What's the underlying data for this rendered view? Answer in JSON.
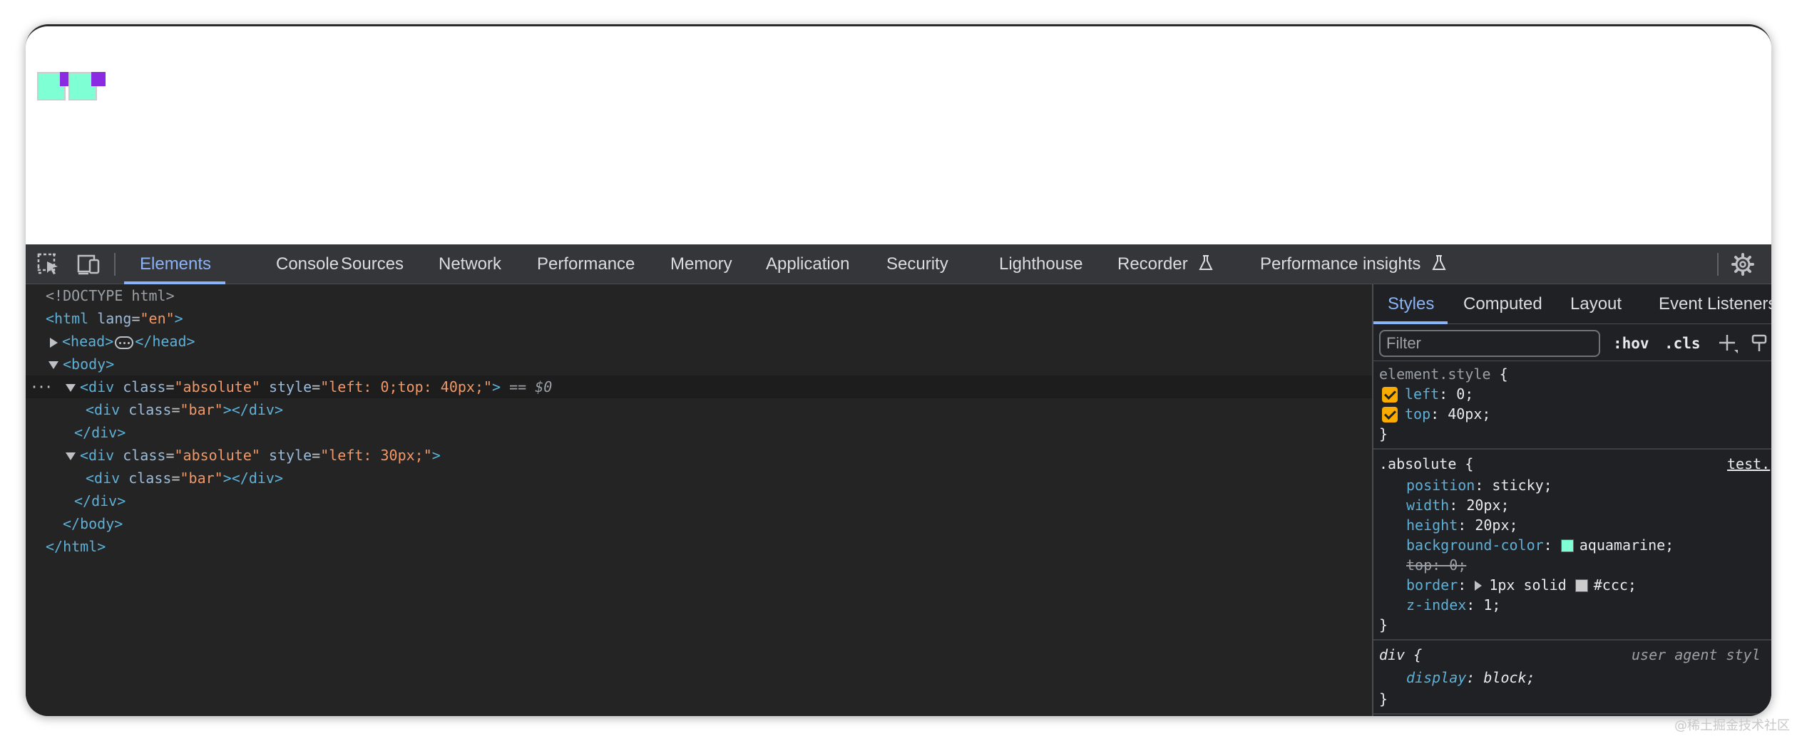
{
  "devtools": {
    "tabs": [
      {
        "label": "Elements"
      },
      {
        "label": "Console"
      },
      {
        "label": "Sources"
      },
      {
        "label": "Network"
      },
      {
        "label": "Performance"
      },
      {
        "label": "Memory"
      },
      {
        "label": "Application"
      },
      {
        "label": "Security"
      },
      {
        "label": "Lighthouse"
      },
      {
        "label": "Recorder"
      },
      {
        "label": "Performance insights"
      }
    ],
    "active_tab": "Elements",
    "toolbar_icons": [
      "inspect-element-icon",
      "device-toolbar-icon",
      "flask-icon",
      "gear-icon"
    ]
  },
  "dom": {
    "doctype": "<!DOCTYPE html>",
    "html_open": "<html",
    "html_lang_attr": "lang",
    "html_lang_val": "\"en\"",
    "html_close_bracket": ">",
    "head_open": "<head>",
    "head_close": "</head>",
    "body_open": "<body>",
    "div_open": "<div",
    "class_attr": "class",
    "style_attr": "style",
    "absolute_val": "\"absolute\"",
    "bar_val": "\"bar\"",
    "div1_style_val": "\"left: 0;top: 40px;\"",
    "div2_style_val": "\"left: 30px;\"",
    "eq_dollar": "== $0",
    "div_close_bracket": ">",
    "div_close_tag": "</div>",
    "body_close": "</body>",
    "html_close": "</html>",
    "selected_gutter": "···"
  },
  "styles_panel": {
    "tabs": [
      "Styles",
      "Computed",
      "Layout",
      "Event Listeners"
    ],
    "active_tab": "Styles",
    "filter_placeholder": "Filter",
    "hov_label": ":hov",
    "cls_label": ".cls",
    "rules": {
      "element_style_selector": "element.style",
      "open_brace": " {",
      "close_brace": "}",
      "left_prop": "left",
      "left_val": "0;",
      "top_prop": "top",
      "top_val": "40px;",
      "absolute_selector": ".absolute",
      "absolute_source": "test.",
      "position_prop": "position",
      "position_val": "sticky;",
      "width_prop": "width",
      "width_val": "20px;",
      "height_prop": "height",
      "height_val": "20px;",
      "bg_prop": "background-color",
      "bg_val": "aquamarine;",
      "top_overridden": "top: 0;",
      "border_prop": "border",
      "border_val_a": "1px solid",
      "border_val_b": "#ccc;",
      "zindex_prop": "z-index",
      "zindex_val": "1;",
      "div_selector": "div",
      "user_agent_label": "user agent styl",
      "display_prop": "display",
      "display_val": "block;"
    }
  },
  "colors": {
    "aquamarine": "#7fffd4",
    "bar": "#8a2be2",
    "ccc": "#cccccc",
    "devtools_bg": "#202124",
    "accent": "#8ab4f8",
    "checkbox": "#f9ab00"
  },
  "watermark": "@稀土掘金技术社区"
}
